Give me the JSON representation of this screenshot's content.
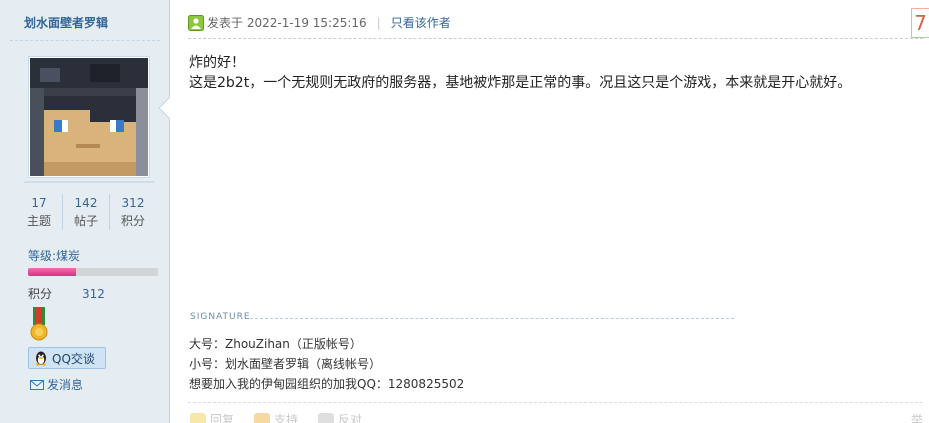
{
  "author": {
    "name": "划水面壁者罗辑",
    "stats": [
      {
        "value": "17",
        "label": "主题"
      },
      {
        "value": "142",
        "label": "帖子"
      },
      {
        "value": "312",
        "label": "积分"
      }
    ],
    "level_label": "等级:煤炭",
    "level_progress_fraction": 0.37,
    "credit_label": "积分",
    "credit_value": "312",
    "qq_button": "QQ交谈",
    "message_link": "发消息"
  },
  "post": {
    "posted_prefix": "发表于",
    "timestamp": "2022-1-19 15:25:16",
    "only_author": "只看该作者",
    "floor_number": "7",
    "content_lines": [
      "炸的好！",
      "这是2b2t，一个无规则无政府的服务器，基地被炸那是正常的事。况且这只是个游戏，本来就是开心就好。"
    ],
    "signature_label": "SIGNATURE",
    "signature_lines": [
      "大号：ZhouZihan（正版帐号）",
      "小号：划水面壁者罗辑（离线帐号）",
      "想要加入我的伊甸园组织的加我QQ：1280825502"
    ],
    "footer": {
      "reply": "回复",
      "support": "支持",
      "oppose": "反对",
      "right": "举"
    }
  },
  "colors": {
    "sidebar_bg": "#e5edf2",
    "link": "#336699",
    "progress_fill": "#e83e8c"
  }
}
